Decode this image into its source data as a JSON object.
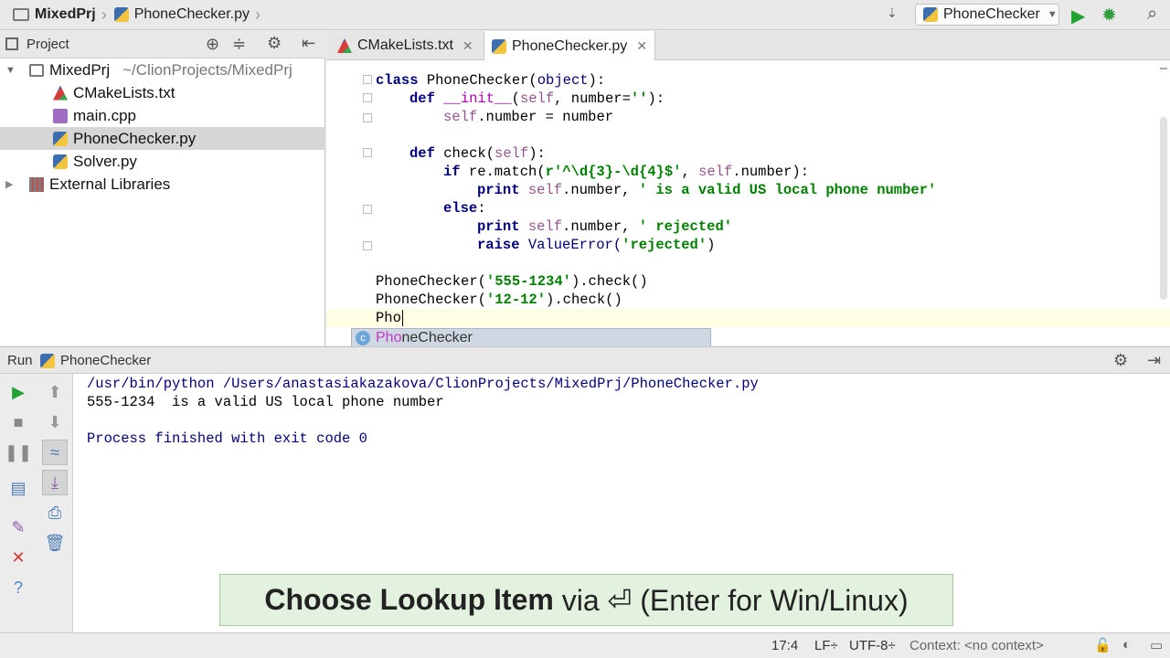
{
  "topbar": {
    "breadcrumb": [
      "MixedPrj",
      "PhoneChecker.py"
    ],
    "run_config": "PhoneChecker"
  },
  "project": {
    "header": "Project",
    "root_name": "MixedPrj",
    "root_path": "~/ClionProjects/MixedPrj",
    "files": [
      "CMakeLists.txt",
      "main.cpp",
      "PhoneChecker.py",
      "Solver.py"
    ],
    "selected_file": "PhoneChecker.py",
    "external": "External Libraries"
  },
  "editor": {
    "tabs": [
      "CMakeLists.txt",
      "PhoneChecker.py"
    ],
    "active_tab": "PhoneChecker.py",
    "code": {
      "l1_kw": "class ",
      "l1_name": "PhoneChecker(",
      "l1_base": "object",
      "l1_end": "):",
      "l2_kw": "def ",
      "l2_name": "__init__",
      "l2_p1": "(",
      "l2_self": "self",
      "l2_p2": ", number=",
      "l2_str": "''",
      "l2_end": "):",
      "l3_self": "self",
      "l3_rest": ".number = number",
      "l5_kw": "def ",
      "l5_name": "check(",
      "l5_self": "self",
      "l5_end": "):",
      "l6_kw": "if ",
      "l6_a": "re.match(",
      "l6_str": "r'^\\d{3}-\\d{4}$'",
      "l6_b": ", ",
      "l6_self": "self",
      "l6_c": ".number):",
      "l7_kw": "print ",
      "l7_self": "self",
      "l7_a": ".number, ",
      "l7_str": "' is a valid US local phone number'",
      "l8_kw": "else",
      "l8_end": ":",
      "l9_kw": "print ",
      "l9_self": "self",
      "l9_a": ".number, ",
      "l9_str": "' rejected'",
      "l10_kw": "raise ",
      "l10_exc": "ValueError(",
      "l10_str": "'rejected'",
      "l10_end": ")",
      "l12_a": "PhoneChecker(",
      "l12_str": "'555-1234'",
      "l12_b": ").check()",
      "l13_a": "PhoneChecker(",
      "l13_str": "'12-12'",
      "l13_b": ").check()",
      "l14": "Pho"
    },
    "completion": {
      "icon": "c",
      "match": "Pho",
      "rest": "neChecker"
    }
  },
  "run": {
    "label": "Run",
    "config": "PhoneChecker",
    "output": [
      "/usr/bin/python /Users/anastasiakazakova/ClionProjects/MixedPrj/PhoneChecker.py",
      "555-1234  is a valid US local phone number",
      "",
      "Process finished with exit code 0"
    ]
  },
  "status": {
    "position": "17:4",
    "line_sep": "LF÷",
    "encoding": "UTF-8÷",
    "context": "Context: <no context>"
  },
  "banner": {
    "bold": "Choose Lookup Item",
    "rest": " via ⏎ (Enter for Win/Linux)"
  }
}
